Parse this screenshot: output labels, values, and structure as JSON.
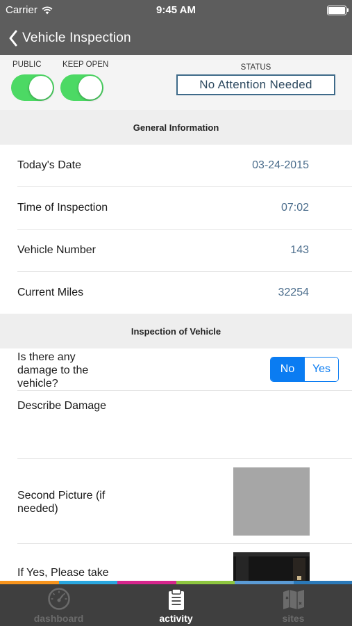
{
  "status_bar": {
    "carrier": "Carrier",
    "time": "9:45 AM"
  },
  "nav": {
    "title": "Vehicle Inspection"
  },
  "controls": {
    "public_label": "PUBLIC",
    "keep_open_label": "KEEP OPEN",
    "status_label": "STATUS",
    "status_value": "No Attention Needed"
  },
  "general": {
    "header": "General Information",
    "rows": [
      {
        "label": "Today's Date",
        "value": "03-24-2015"
      },
      {
        "label": "Time of Inspection",
        "value": "07:02"
      },
      {
        "label": "Vehicle Number",
        "value": "143"
      },
      {
        "label": "Current Miles",
        "value": "32254"
      }
    ]
  },
  "inspection": {
    "header": "Inspection of Vehicle",
    "damage_question": "Is there any damage to the vehicle?",
    "option_no": "No",
    "option_yes": "Yes",
    "describe_damage": "Describe Damage",
    "second_picture": "Second Picture (if needed)",
    "if_yes": "If Yes, Please take"
  },
  "tabs": {
    "dashboard": "dashboard",
    "activity": "activity",
    "sites": "sites"
  },
  "colors": {
    "header_bg": "#5d5d5d",
    "toggle_on": "#4cd964",
    "status_border": "#3e6a89",
    "value_text": "#4b6d8c",
    "segment_blue": "#0a7cf2",
    "strip": [
      "#f7941d",
      "#2aa7df",
      "#d6258c",
      "#8dc63f",
      "#5b9bd5",
      "#2b79b8"
    ]
  }
}
